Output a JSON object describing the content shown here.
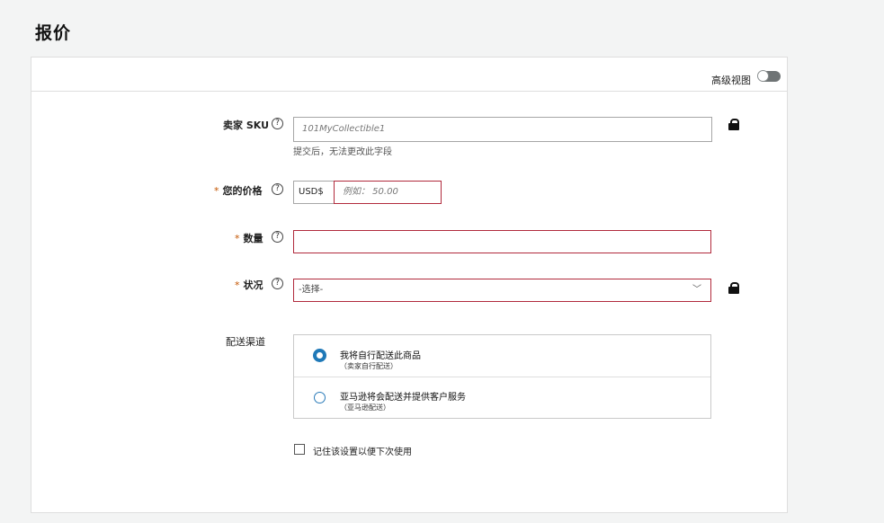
{
  "page": {
    "title": "报价"
  },
  "header": {
    "advanced_view_label": "高级视图",
    "advanced_view_on": false
  },
  "fields": {
    "sku": {
      "label": "卖家 SKU",
      "value": "101MyCollectible1",
      "helper": "提交后，无法更改此字段",
      "locked": true,
      "help_icon": "question-circle-icon"
    },
    "price": {
      "required_mark": "*",
      "label": "您的价格",
      "currency": "USD$",
      "placeholder": "例如： 50.00"
    },
    "quantity": {
      "required_mark": "*",
      "label": "数量",
      "value": ""
    },
    "condition": {
      "required_mark": "*",
      "label": "状况",
      "selected": "-选择-",
      "locked": true
    },
    "fulfillment": {
      "label": "配送渠道",
      "options": [
        {
          "title": "我将自行配送此商品",
          "subtitle": "（卖家自行配送）",
          "selected": true
        },
        {
          "title": "亚马逊将会配送并提供客户服务",
          "subtitle": "（亚马逊配送）",
          "selected": false
        }
      ]
    },
    "remember": {
      "label": "记住该设置以便下次使用",
      "checked": false
    }
  },
  "colors": {
    "error_border": "#b12a3c",
    "radio_accent": "#1f79b8"
  }
}
